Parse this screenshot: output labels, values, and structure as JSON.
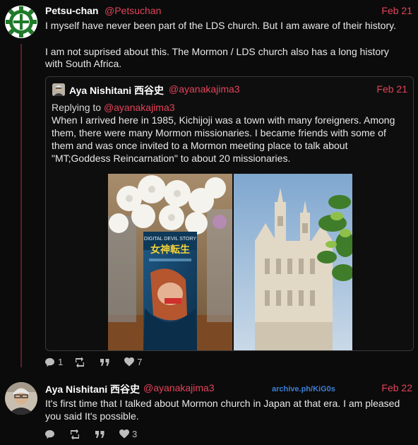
{
  "post1": {
    "author_name": "Petsu-chan",
    "author_handle": "@Petsuchan",
    "date": "Feb 21",
    "text_line1": "I myself have never been part of the LDS church. But I am aware of their history.",
    "text_para2_l1": "I am not suprised about this. The Mormon / LDS church also has a long history",
    "text_para2_l2": "with South Africa.",
    "quote": {
      "author_name": "Aya Nishitani 西谷史",
      "author_handle": "@ayanakajima3",
      "date": "Feb 21",
      "replying_prefix": "Replying to ",
      "replying_handle": "@ayanakajima3",
      "text_l1": "When I arrived here in 1985, Kichijoji was a town with many foreigners.   Among",
      "text_l2": "them, there were many Mormon missionaries.   I became friends with some of",
      "text_l3": "them and was once invited to a Mormon meeting place to talk about",
      "text_l4": "\"MT;Goddess Reincarnation\" to about 20 missionaries.",
      "book_title_en": "DIGITAL DEVIL STORY",
      "book_title_jp": "女神転生"
    },
    "actions": {
      "reply_count": "1",
      "retweet_count": "",
      "quote_count": "",
      "like_count": "7"
    }
  },
  "post2": {
    "author_name": "Aya Nishitani 西谷史",
    "author_handle": "@ayanakajima3",
    "date": "Feb 22",
    "archive_link": "archive.ph/KiG0s",
    "text_l1": "It's first time that I talked about Mormon church in Japan at that era. I am pleased",
    "text_l2": "you said It's possible.",
    "actions": {
      "reply_count": "",
      "retweet_count": "",
      "quote_count": "",
      "like_count": "3"
    }
  },
  "icons": {
    "reply": "speech-bubble-icon",
    "retweet": "retweet-icon",
    "quote": "quote-icon",
    "like": "heart-icon"
  },
  "colors": {
    "background": "#0b0b0b",
    "accent": "#e4435a",
    "link": "#3d7fd6",
    "thread_line": "#5a2027"
  }
}
